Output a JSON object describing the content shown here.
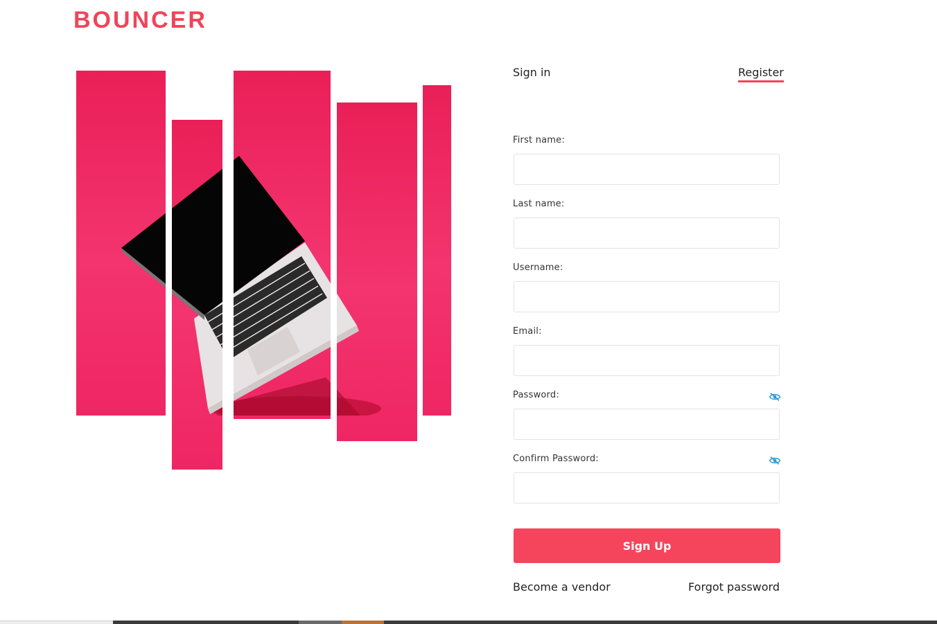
{
  "brand": {
    "name": "BOUNCER",
    "color": "#f04459"
  },
  "tabs": {
    "signin": "Sign in",
    "register": "Register",
    "active": "register"
  },
  "form": {
    "first_name_label": "First name:",
    "last_name_label": "Last name:",
    "username_label": "Username:",
    "email_label": "Email:",
    "password_label": "Password:",
    "confirm_password_label": "Confirm Password:",
    "first_name_value": "",
    "last_name_value": "",
    "username_value": "",
    "email_value": "",
    "password_value": "",
    "confirm_password_value": "",
    "password_toggle_icon": "eye-slash-icon",
    "confirm_password_toggle_icon": "eye-slash-icon"
  },
  "actions": {
    "signup_label": "Sign Up",
    "become_vendor": "Become a vendor",
    "forgot_password": "Forgot password"
  },
  "hero": {
    "icon": "laptop-image",
    "accent": "#ef2663"
  },
  "colors": {
    "accent": "#f5455c",
    "eye_icon": "#2a9bd8"
  }
}
